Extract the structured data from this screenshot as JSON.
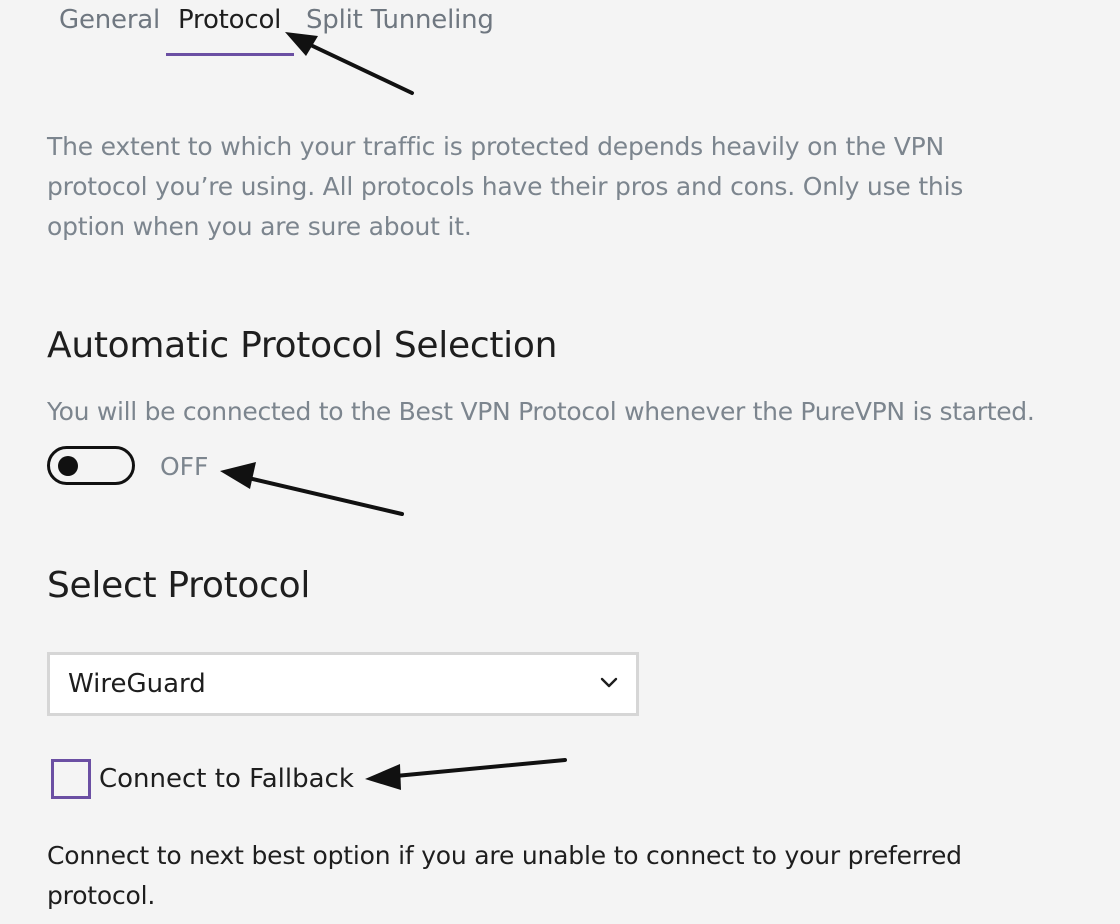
{
  "tabs": [
    {
      "label": "General",
      "active": false
    },
    {
      "label": "Protocol",
      "active": true
    },
    {
      "label": "Split Tunneling",
      "active": false
    }
  ],
  "intro_text": "The extent to which your traffic is protected depends heavily on the VPN protocol you’re using. All protocols have their pros and cons. Only use this option when you are sure about it.",
  "auto_protocol": {
    "heading": "Automatic Protocol Selection",
    "description": "You will be connected to the Best VPN Protocol whenever the PureVPN is started.",
    "toggle_state": "OFF",
    "enabled": false
  },
  "select_protocol": {
    "heading": "Select Protocol",
    "selected_value": "WireGuard",
    "dropdown_icon": "chevron-down-icon"
  },
  "fallback": {
    "label": "Connect to Fallback",
    "checked": false,
    "description": "Connect to next best option if you are unable to connect to your preferred protocol."
  },
  "colors": {
    "accent": "#6b4fa3",
    "background": "#f4f4f4",
    "muted_text": "#7c858e",
    "primary_text": "#1e1e1e"
  }
}
